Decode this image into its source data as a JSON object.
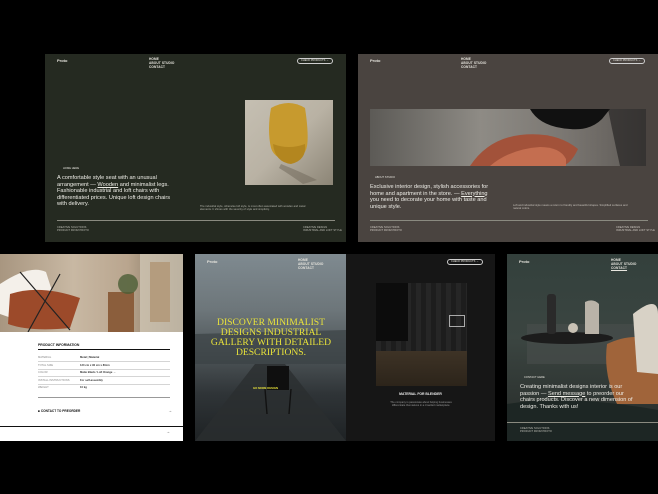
{
  "slide1": {
    "logo": "Proto",
    "nav": [
      "HOME",
      "ABOUT STUDIO",
      "CONTACT"
    ],
    "button": "CHECK PRODUCTS",
    "button_arrow": "→",
    "section_label": "HOME HERE",
    "headline_pre": "A comfortable style seat with an unusual arrangement — ",
    "headline_link": "Wooden",
    "headline_post": " and minimalist legs. Fashionable industrial and loft chairs with differentiated prices. Unique loft design chairs with delivery.",
    "side_text": "The industrial style, otherwise loft style, is most often associated with wooden and metal elements. It shines with the severity of style and simplicity.",
    "footer_left": [
      "CREATIVE SOLUTIONS",
      "PRODUCT FROM PROTO"
    ],
    "footer_right": [
      "CREATIVE DESIGN",
      "INDUSTRIAL AND LOFT STYLE"
    ]
  },
  "slide2": {
    "logo": "Proto",
    "nav": [
      "HOME",
      "ABOUT STUDIO",
      "CONTACT"
    ],
    "button": "CHECK PRODUCTS",
    "button_arrow": "→",
    "section_label": "ABOUT STUDIO",
    "headline_pre": "Exclusive interior design, stylish accessories for home and apartment in the store. — ",
    "headline_link": "Everything",
    "headline_post": " you need to decorate your home with taste and unique style.",
    "side_text": "Loft and industrial style means a return to friendly and beautiful shapes. Simplified surfaces and natural colors.",
    "footer_left": [
      "CREATIVE SOLUTIONS",
      "PRODUCT FROM PROTO"
    ],
    "footer_right": [
      "CREATIVE DESIGN",
      "INDUSTRIAL AND LOFT STYLE"
    ]
  },
  "slide3": {
    "title": "PRODUCT INFORMATION",
    "rows": [
      {
        "label": "MATERIAL",
        "value": "Metal | Material"
      },
      {
        "label": "TOTAL SIZE",
        "value": "120 cm x 90 cm x 80cm"
      },
      {
        "label": "COLOR",
        "value": "Matte Black / Loft Orange →"
      },
      {
        "label": "INSTALL INSTRUCTIONS",
        "value": "For self-assembly"
      },
      {
        "label": "WEIGHT",
        "value": "10 kg"
      }
    ],
    "contact": "CONTACT TO PREORDER",
    "arrow": "→"
  },
  "slide4": {
    "logo": "Proto",
    "nav": [
      "HOME",
      "ABOUT STUDIO",
      "CONTACT"
    ],
    "headline": "DISCOVER MINIMALIST DESIGNS INDUSTRIAL GALLERY WITH DETAILED DESCRIPTIONS.",
    "cta": "GO MORE DESIGN"
  },
  "slide5": {
    "button": "CHECK PRODUCTS",
    "button_arrow": "→",
    "title": "MATERIAL FOR BLENDER",
    "text": "The company is passionate about helping businesses differentiate themselves in a crowded marketplace."
  },
  "slide6": {
    "logo": "Proto",
    "nav": [
      "HOME",
      "ABOUT STUDIO",
      "CONTACT"
    ],
    "section_label": "CONTACT HERE",
    "headline_pre": "Creating minimalist designs interior is our passion — ",
    "headline_link": "Send message",
    "headline_post": " to preorder our chairs products. Discover a new dimension of design. Thanks with us!",
    "footer": [
      "CREATIVE SOLUTIONS",
      "PRODUCT FROM PROTO"
    ]
  }
}
